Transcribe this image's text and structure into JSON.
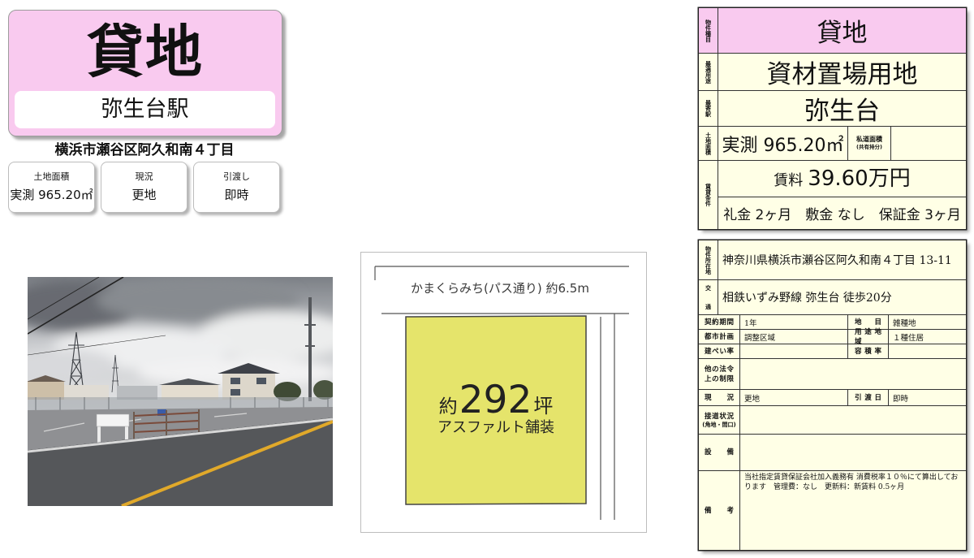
{
  "colors": {
    "title_pink": "#f9caef",
    "table_cream": "#ffffe6",
    "lot_yellow": "#e5e46b"
  },
  "flyer": {
    "title": "貸地",
    "station": "弥生台駅",
    "address": "横浜市瀬谷区阿久和南４丁目",
    "summary": [
      {
        "label": "土地面積",
        "value": "実測 965.20㎡"
      },
      {
        "label": "現況",
        "value": "更地"
      },
      {
        "label": "引渡し",
        "value": "即時"
      }
    ]
  },
  "site_map": {
    "road_label": "かまくらみち(パス通り) 約6.5m",
    "area_prefix": "約",
    "area_value": "292",
    "area_unit": "坪",
    "surface": "アスファルト舗装"
  },
  "summary_table": {
    "type": {
      "label": "物件種目",
      "value": "貸地"
    },
    "use": {
      "label": "最適用途",
      "value": "資材置場用地"
    },
    "station": {
      "label": "最寄駅",
      "value": "弥生台"
    },
    "area": {
      "label": "土地面積",
      "value": "実測 965.20㎡",
      "private_road_label": "私道面積",
      "private_road_note": "(共有持分)"
    },
    "terms": {
      "label": "賃貸条件",
      "rent_label": "賃料",
      "rent_value": "39.60万円",
      "conditions": "礼金 2ヶ月　敷金 なし　保証金 3ヶ月"
    }
  },
  "detail_table": {
    "location": {
      "label": "物件所在地",
      "value": "神奈川県横浜市瀬谷区阿久和南４丁目 13-11"
    },
    "access": {
      "label": "交通",
      "value": "相鉄いずみ野線 弥生台 徒歩20分"
    },
    "contract": {
      "label": "契約期間",
      "value": "1年",
      "label2": "地目",
      "value2": "雑種地"
    },
    "planning": {
      "label": "都市計画",
      "value": "調整区域",
      "label2": "用途地域",
      "value2": "１種住居"
    },
    "ratio": {
      "label": "建ぺい率",
      "label2": "容積率"
    },
    "regulations": {
      "label": "他の法令上の制限"
    },
    "status": {
      "label": "現況",
      "value": "更地",
      "label2": "引渡日",
      "value2": "即時"
    },
    "road_access": {
      "label": "接道状況",
      "note": "(角地・間口)"
    },
    "facilities": {
      "label": "設備"
    },
    "remarks": {
      "label": "備考",
      "value": "当社指定賃貸保証会社加入義務有 消費税率１０％にて算出しております　管理費：なし　更新料：新賃料 0.5ヶ月"
    }
  }
}
